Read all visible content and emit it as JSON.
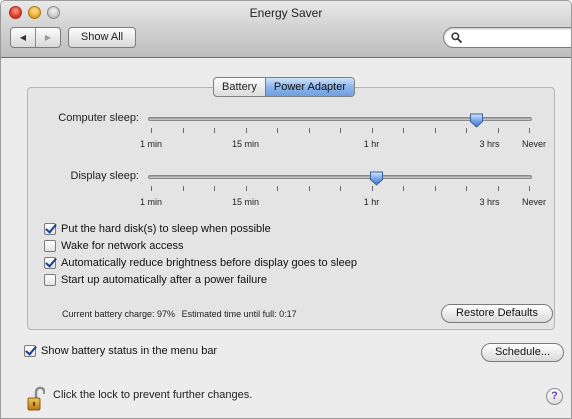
{
  "window": {
    "title": "Energy Saver"
  },
  "toolbar": {
    "back_glyph": "◀",
    "forward_glyph": "▶",
    "show_all_label": "Show All",
    "search_icon": "magnifier-icon",
    "search_value": "",
    "search_placeholder": ""
  },
  "tabs": [
    {
      "label": "Battery",
      "selected": false
    },
    {
      "label": "Power Adapter",
      "selected": true
    }
  ],
  "sliders": {
    "tick_labels": [
      "1 min",
      "15 min",
      "1 hr",
      "3 hrs",
      "Never"
    ],
    "computer_sleep": {
      "label": "Computer sleep:",
      "value": "3 hrs"
    },
    "display_sleep": {
      "label": "Display sleep:",
      "value": "1 hr"
    }
  },
  "options": [
    {
      "label": "Put the hard disk(s) to sleep when possible",
      "checked": true
    },
    {
      "label": "Wake for network access",
      "checked": false
    },
    {
      "label": "Automatically reduce brightness before display goes to sleep",
      "checked": true
    },
    {
      "label": "Start up automatically after a power failure",
      "checked": false
    }
  ],
  "status": {
    "charge": "Current battery charge: 97%",
    "time_until_full": "Estimated time until full: 0:17"
  },
  "buttons": {
    "restore_defaults": "Restore Defaults",
    "schedule": "Schedule..."
  },
  "menu_bar_option": {
    "label": "Show battery status in the menu bar",
    "checked": true
  },
  "lock": {
    "icon": "open-lock-icon",
    "text": "Click the lock to prevent further changes."
  },
  "help": {
    "glyph": "?"
  },
  "colors": {
    "selected_tab": "#8eb6ec",
    "check_mark": "#1a3f8a",
    "help_question": "#6a3fb5"
  }
}
